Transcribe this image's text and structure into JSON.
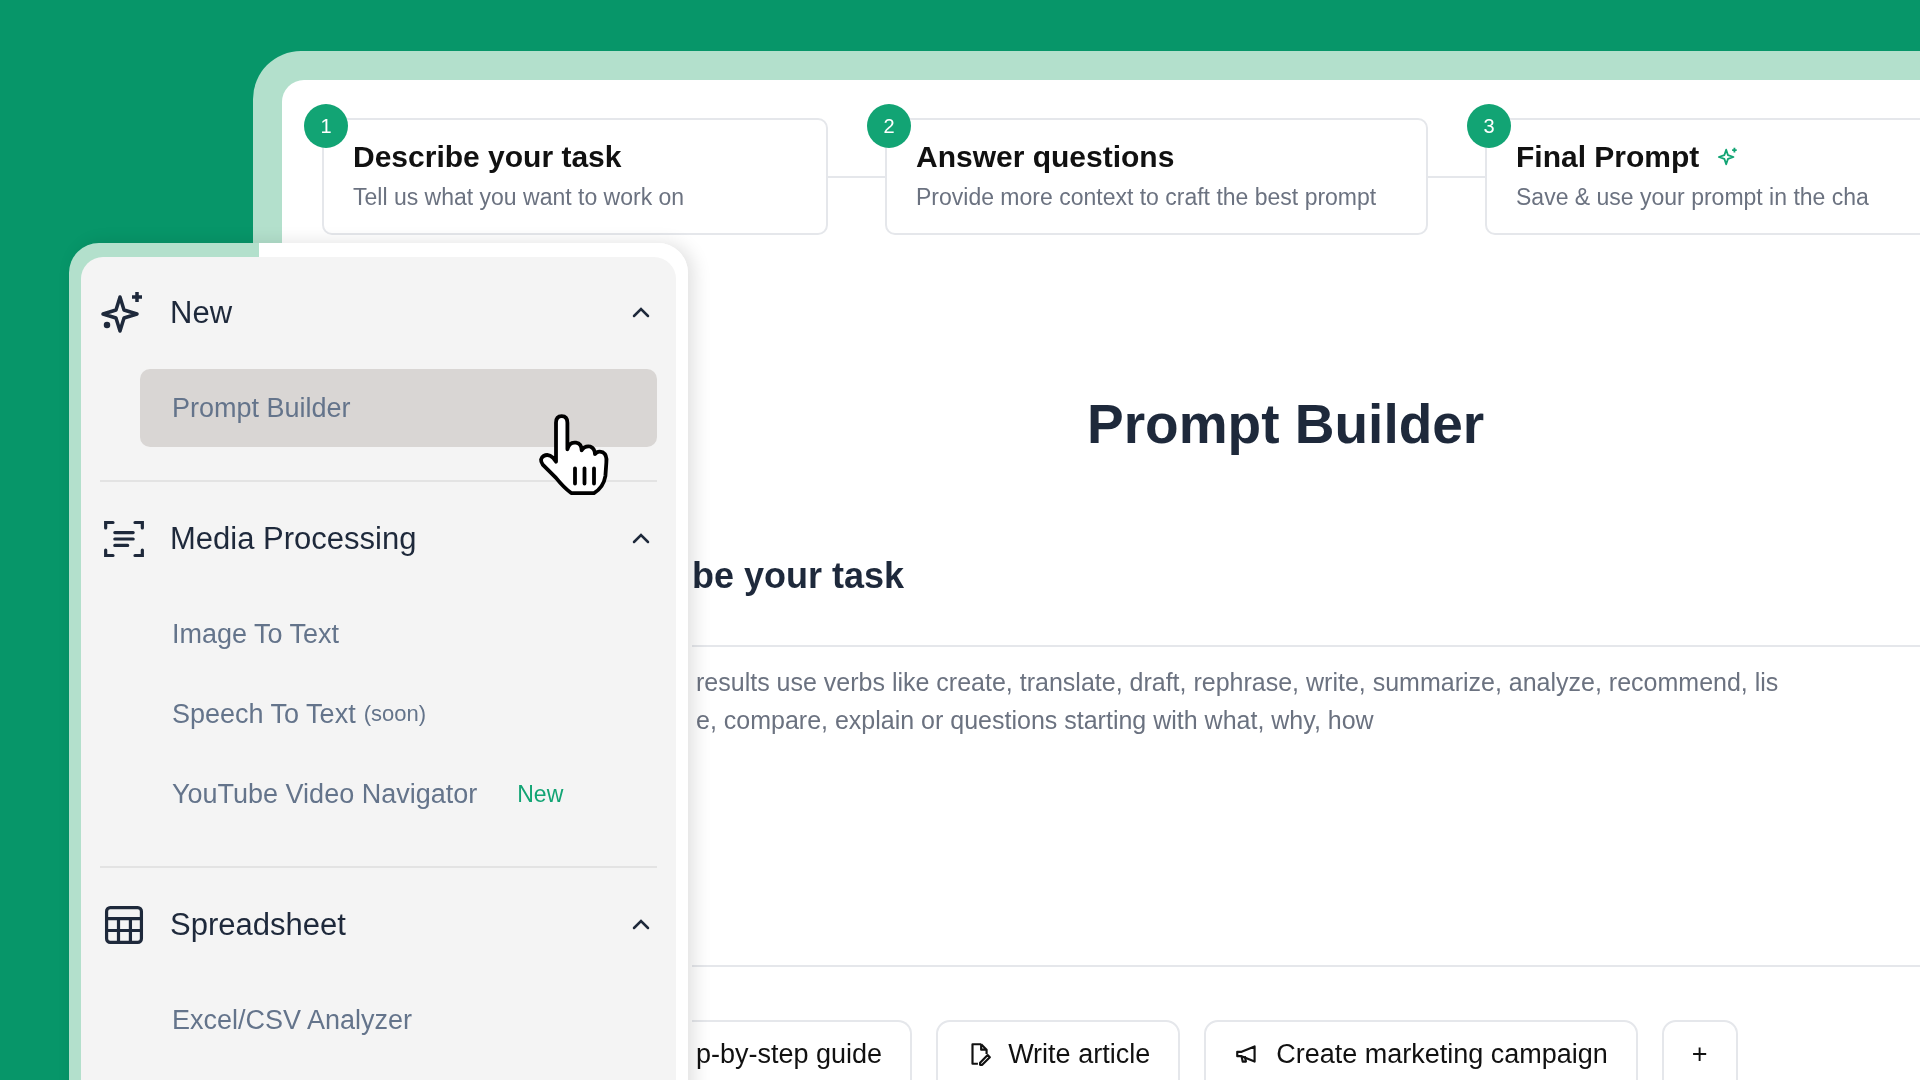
{
  "steps": [
    {
      "number": "1",
      "title": "Describe your task",
      "subtitle": "Tell us what you want to work on",
      "sparkle": false
    },
    {
      "number": "2",
      "title": "Answer questions",
      "subtitle": "Provide more context to craft the best prompt",
      "sparkle": false
    },
    {
      "number": "3",
      "title": "Final Prompt",
      "subtitle": "Save & use your prompt in the cha",
      "sparkle": true
    }
  ],
  "page_title": "Prompt Builder",
  "section_title": "be your task",
  "task_field": {
    "placeholder": "results use verbs like create, translate, draft, rephrase, write, summarize, analyze, recommend, lis\ne, compare, explain or questions starting with what, why, how"
  },
  "suggestions": [
    {
      "label": "p-by-step guide"
    },
    {
      "label": "Write article"
    },
    {
      "label": "Create marketing campaign"
    },
    {
      "label": "+"
    }
  ],
  "sidebar": {
    "groups": [
      {
        "title": "New",
        "expanded": true,
        "items": [
          {
            "label": "Prompt Builder",
            "selected": true
          }
        ]
      },
      {
        "title": "Media Processing",
        "expanded": true,
        "items": [
          {
            "label": "Image To Text",
            "selected": false
          },
          {
            "label": "Speech To Text",
            "note": "(soon)",
            "selected": false
          },
          {
            "label": "YouTube Video Navigator",
            "badge": "New",
            "selected": false
          }
        ]
      },
      {
        "title": "Spreadsheet",
        "expanded": true,
        "items": [
          {
            "label": "Excel/CSV Analyzer",
            "selected": false
          }
        ]
      }
    ]
  }
}
